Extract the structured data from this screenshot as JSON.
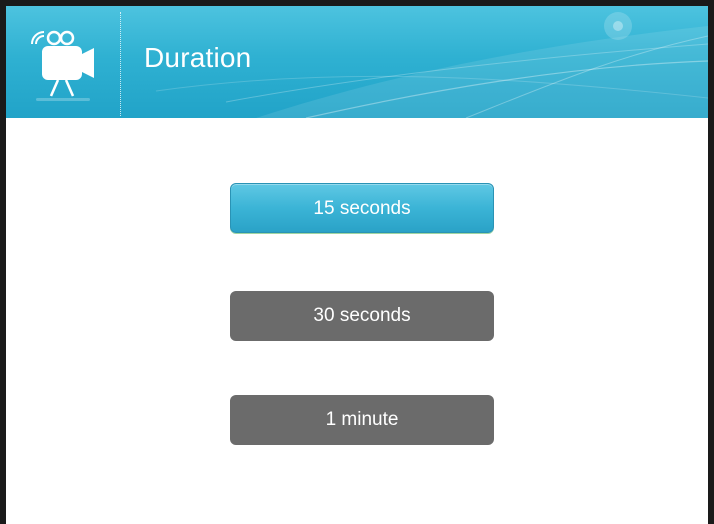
{
  "header": {
    "title": "Duration",
    "icon": "video-camera-icon"
  },
  "options": {
    "items": [
      {
        "label": "15 seconds",
        "selected": true
      },
      {
        "label": "30 seconds",
        "selected": false
      },
      {
        "label": "1 minute",
        "selected": false
      }
    ]
  },
  "colors": {
    "header_accent": "#2fb1d2",
    "selected_button": "#3bb4d6",
    "unselected_button": "#6b6b6b",
    "frame": "#1a1a1a"
  }
}
